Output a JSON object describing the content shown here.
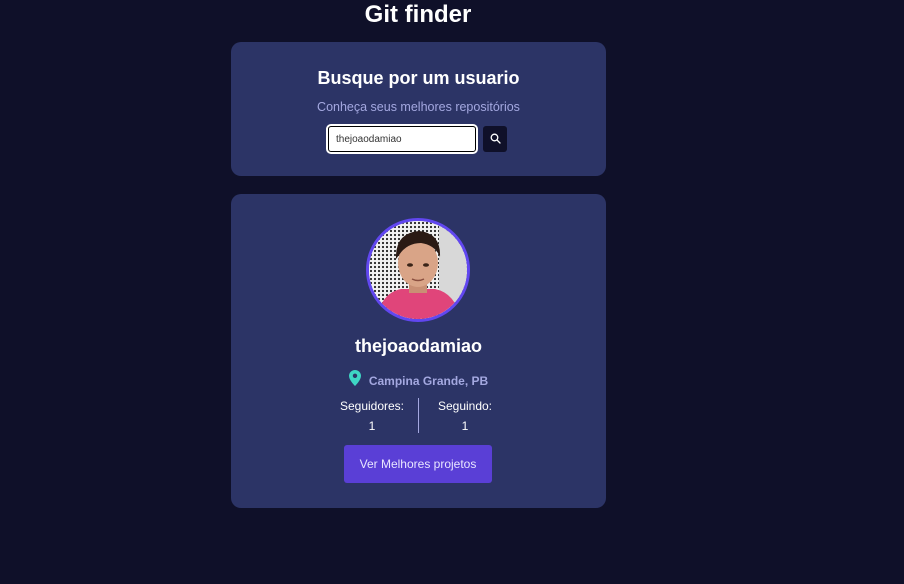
{
  "app": {
    "title": "Git finder"
  },
  "search": {
    "heading": "Busque por um usuario",
    "subtitle": "Conheça seus melhores repositórios",
    "input_value": "thejoaodamiao",
    "button_icon": "search-icon"
  },
  "profile": {
    "avatar_icon": "avatar-photo",
    "username": "thejoaodamiao",
    "location_icon": "map-pin-icon",
    "location": "Campina Grande, PB",
    "followers_label": "Seguidores:",
    "followers_value": "1",
    "following_label": "Seguindo:",
    "following_value": "1",
    "projects_button": "Ver Melhores projetos"
  },
  "colors": {
    "background": "#0f1029",
    "card": "#2c3466",
    "accent": "#5a3fd6",
    "avatar_ring": "#6147f0",
    "pin": "#3ed6c4",
    "muted_text": "#a4a8e0"
  }
}
